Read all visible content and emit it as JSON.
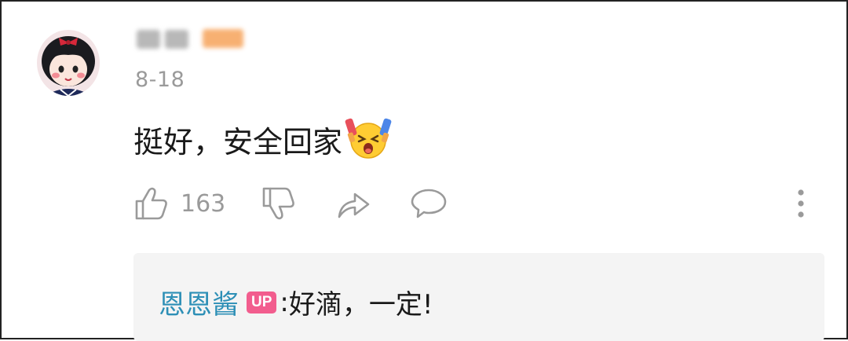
{
  "comment": {
    "date": "8-18",
    "text": "挺好，安全回家",
    "emoji": "cheering-face-emoji",
    "like_count": "163"
  },
  "reply": {
    "author": "恩恩酱",
    "badge": "UP",
    "separator": ":",
    "text": "好滴，一定!"
  },
  "icons": {
    "like": "thumbs-up-icon",
    "dislike": "thumbs-down-icon",
    "share": "share-arrow-icon",
    "reply": "speech-bubble-icon",
    "more": "vertical-dots-icon"
  },
  "colors": {
    "reply_name": "#2d8fb6",
    "up_badge": "#f25d8e",
    "muted_text": "#9a9a9a",
    "reply_bg": "#f4f4f4"
  }
}
